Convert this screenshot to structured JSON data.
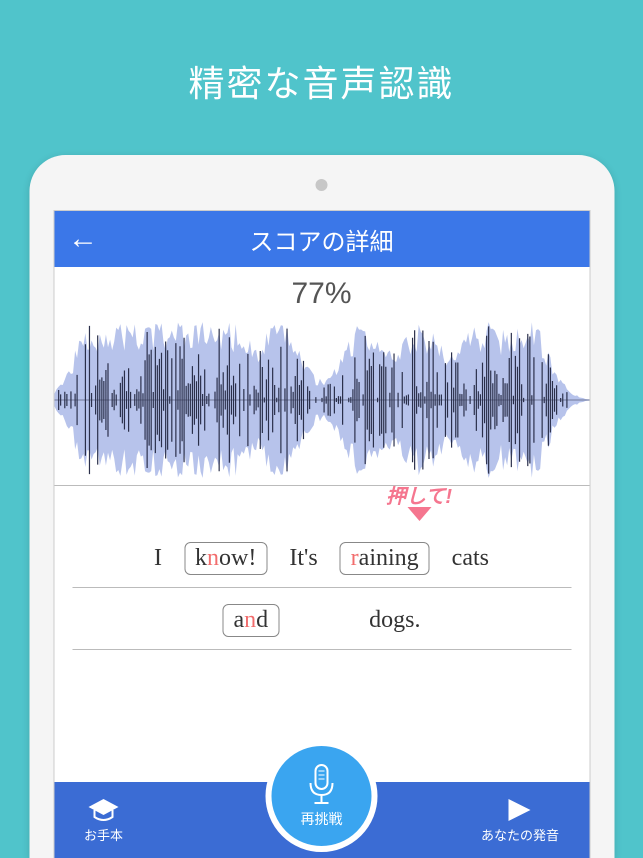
{
  "promo": {
    "title": "精密な音声認識"
  },
  "header": {
    "title": "スコアの詳細"
  },
  "score": {
    "text": "77%"
  },
  "tooltip": {
    "text": "押して!"
  },
  "sentence": {
    "line1": [
      {
        "text": "I",
        "boxed": false
      },
      {
        "pre": "k",
        "hl": "n",
        "post": "ow!",
        "boxed": true
      },
      {
        "text": "It's",
        "boxed": false
      },
      {
        "hl": "r",
        "post": "aining",
        "boxed": true
      },
      {
        "text": "cats",
        "boxed": false
      }
    ],
    "line2": [
      {
        "pre": "a",
        "hl": "n",
        "post": "d",
        "boxed": true
      },
      {
        "text": "dogs.",
        "boxed": false
      }
    ]
  },
  "bottom": {
    "left": "お手本",
    "center": "再挑戦",
    "right": "あなたの発音"
  }
}
